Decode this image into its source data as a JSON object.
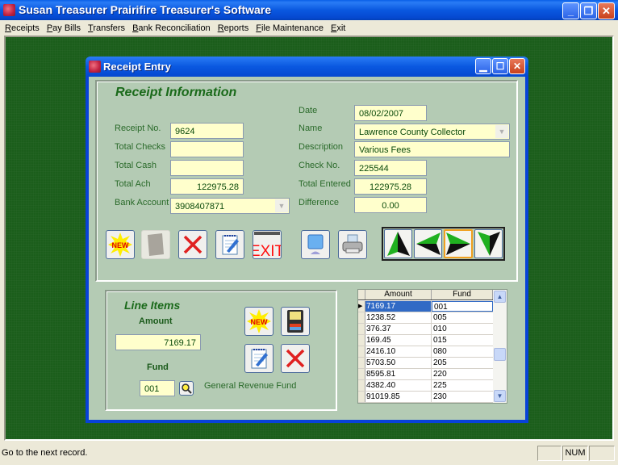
{
  "app": {
    "title": "Susan Treasurer Prairifire Treasurer's Software",
    "window_controls": {
      "minimize": "_",
      "restore": "❐",
      "close": "✕"
    }
  },
  "menu": [
    {
      "label": "Receipts",
      "accel": "R"
    },
    {
      "label": "Pay Bills",
      "accel": "P"
    },
    {
      "label": "Transfers",
      "accel": "T"
    },
    {
      "label": "Bank Reconciliation",
      "accel": "B"
    },
    {
      "label": "Reports",
      "accel": "R"
    },
    {
      "label": "File Maintenance",
      "accel": "F"
    },
    {
      "label": "Exit",
      "accel": "E"
    }
  ],
  "receipt_window": {
    "title": "Receipt Entry",
    "section_title": "Receipt Information",
    "fields": {
      "receipt_no": {
        "label": "Receipt No.",
        "value": "9624"
      },
      "total_checks": {
        "label": "Total Checks",
        "value": ""
      },
      "total_cash": {
        "label": "Total Cash",
        "value": ""
      },
      "total_ach": {
        "label": "Total Ach",
        "value": "122975.28"
      },
      "bank_account": {
        "label": "Bank Account",
        "value": "3908407871"
      },
      "date": {
        "label": "Date",
        "value": "08/02/2007"
      },
      "name": {
        "label": "Name",
        "value": "Lawrence County Collector"
      },
      "description": {
        "label": "Description",
        "value": "Various Fees"
      },
      "check_no": {
        "label": "Check No.",
        "value": "225544"
      },
      "total_entered": {
        "label": "Total Entered",
        "value": "122975.28"
      },
      "difference": {
        "label": "Difference",
        "value": "0.00"
      }
    },
    "toolbar": {
      "new_label": "NEW",
      "exit_label": "EXIT"
    },
    "line_items": {
      "title": "Line Items",
      "amount_label": "Amount",
      "amount_value": "7169.17",
      "fund_label": "Fund",
      "fund_value": "001",
      "fund_name": "General Revenue Fund",
      "new_label": "NEW"
    },
    "grid": {
      "columns": [
        "Amount",
        "Fund"
      ],
      "rows": [
        {
          "amount": "7169.17",
          "fund": "001",
          "selected": true
        },
        {
          "amount": "1238.52",
          "fund": "005"
        },
        {
          "amount": "376.37",
          "fund": "010"
        },
        {
          "amount": "169.45",
          "fund": "015"
        },
        {
          "amount": "2416.10",
          "fund": "080"
        },
        {
          "amount": "5703.50",
          "fund": "205"
        },
        {
          "amount": "8595.81",
          "fund": "220"
        },
        {
          "amount": "4382.40",
          "fund": "225"
        },
        {
          "amount": "91019.85",
          "fund": "230"
        }
      ]
    }
  },
  "status": {
    "message": "Go to the next record.",
    "panes": [
      "",
      "NUM",
      ""
    ]
  }
}
